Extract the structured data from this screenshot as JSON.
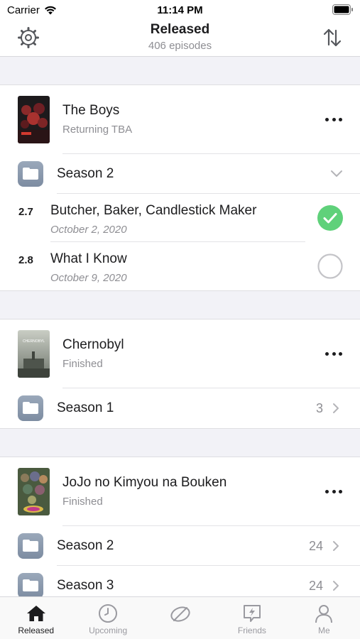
{
  "status_bar": {
    "carrier": "Carrier",
    "time": "11:14 PM"
  },
  "nav": {
    "title": "Released",
    "subtitle": "406 episodes"
  },
  "shows": [
    {
      "title": "The Boys",
      "status": "Returning TBA",
      "season": {
        "label": "Season 2"
      },
      "episodes": [
        {
          "number": "2.7",
          "title": "Butcher, Baker, Candlestick Maker",
          "date": "October 2, 2020",
          "watched": true
        },
        {
          "number": "2.8",
          "title": "What I Know",
          "date": "October 9, 2020",
          "watched": false
        }
      ]
    },
    {
      "title": "Chernobyl",
      "status": "Finished",
      "poster_text": "CHERNOBYL",
      "seasons": [
        {
          "label": "Season 1",
          "count": "3"
        }
      ]
    },
    {
      "title": "JoJo no Kimyou na Bouken",
      "status": "Finished",
      "seasons": [
        {
          "label": "Season 2",
          "count": "24"
        },
        {
          "label": "Season 3",
          "count": "24"
        }
      ]
    }
  ],
  "tabs": [
    {
      "label": "Released",
      "icon": "home-icon",
      "active": true
    },
    {
      "label": "Upcoming",
      "icon": "clock-icon",
      "active": false
    },
    {
      "label": "",
      "icon": "discover-icon",
      "active": false
    },
    {
      "label": "Friends",
      "icon": "friends-bolt-icon",
      "active": false
    },
    {
      "label": "Me",
      "icon": "person-icon",
      "active": false
    }
  ],
  "colors": {
    "accent_green": "#5fd17a",
    "secondary_text": "#8e8e93",
    "background_gray": "#f2f2f7"
  }
}
